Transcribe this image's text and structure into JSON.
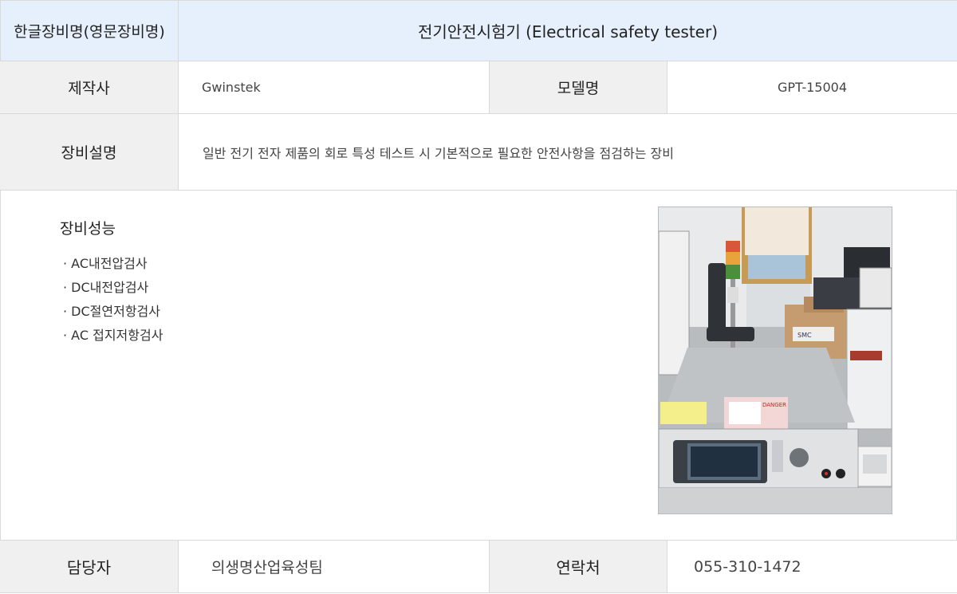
{
  "header": {
    "label": "한글장비명(영문장비명)",
    "equipment_name": "전기안전시험기 (Electrical safety tester)"
  },
  "maker": {
    "label": "제작사",
    "value": "Gwinstek"
  },
  "model": {
    "label": "모델명",
    "value": "GPT-15004"
  },
  "description": {
    "label": "장비설명",
    "value": "일반 전기 전자 제품의 회로 특성 테스트 시 기본적으로 필요한 안전사항을 점검하는 장비"
  },
  "performance": {
    "title": "장비성능",
    "items": [
      "· AC내전압검사",
      "· DC내전압검사",
      "· DC절연저항검사",
      "· AC 접지저항검사"
    ]
  },
  "photo": {
    "label_danger": "DANGER",
    "label_smc": "SMC"
  },
  "manager": {
    "label": "담당자",
    "value": "의생명산업육성팀"
  },
  "contact": {
    "label": "연락처",
    "value": "055-310-1472"
  }
}
